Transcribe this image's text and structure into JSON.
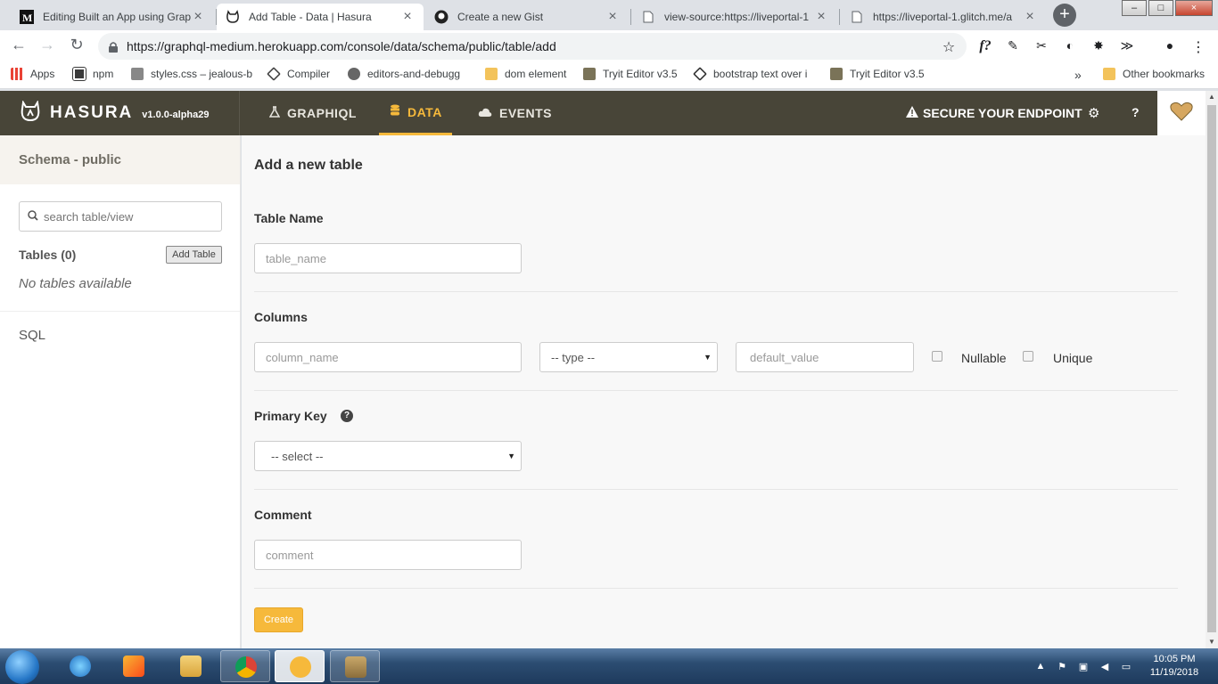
{
  "browser": {
    "tabs": [
      {
        "title": "Editing Built an App using Grap",
        "icon": "medium-icon"
      },
      {
        "title": "Add Table - Data | Hasura",
        "icon": "hasura-icon",
        "active": true
      },
      {
        "title": "Create a new Gist",
        "icon": "github-icon"
      },
      {
        "title": "view-source:https://liveportal-1",
        "icon": "page-icon"
      },
      {
        "title": "https://liveportal-1.glitch.me/a",
        "icon": "page-icon"
      }
    ],
    "new_tab": "+",
    "url": "https://graphql-medium.herokuapp.com/console/data/schema/public/table/add",
    "bookmarks": [
      {
        "label": "Apps"
      },
      {
        "label": "npm"
      },
      {
        "label": "styles.css – jealous-b"
      },
      {
        "label": "Compiler"
      },
      {
        "label": "editors-and-debugg"
      },
      {
        "label": "dom element"
      },
      {
        "label": "Tryit Editor v3.5"
      },
      {
        "label": "bootstrap text over i"
      },
      {
        "label": "Tryit Editor v3.5"
      }
    ],
    "bookmarks_more": "»",
    "other_bookmarks": "Other bookmarks"
  },
  "header": {
    "brand": "HASURA",
    "version": "v1.0.0-alpha29",
    "nav": [
      {
        "label": "GRAPHIQL",
        "icon": "flask-icon"
      },
      {
        "label": "DATA",
        "icon": "database-icon",
        "active": true
      },
      {
        "label": "EVENTS",
        "icon": "cloud-icon"
      }
    ],
    "secure": "SECURE YOUR ENDPOINT",
    "help": "?"
  },
  "sidebar": {
    "schema": "Schema - public",
    "search_placeholder": "search table/view",
    "tables_label": "Tables (0)",
    "add_table": "Add Table",
    "no_tables": "No tables available",
    "sql": "SQL"
  },
  "form": {
    "title": "Add a new table",
    "table_name_label": "Table Name",
    "table_name_placeholder": "table_name",
    "columns_label": "Columns",
    "column_name_placeholder": "column_name",
    "type_select": "-- type --",
    "default_value_placeholder": "default_value",
    "nullable": "Nullable",
    "unique": "Unique",
    "primary_key_label": "Primary Key",
    "primary_key_select": "-- select --",
    "comment_label": "Comment",
    "comment_placeholder": "comment",
    "create": "Create"
  },
  "taskbar": {
    "time": "10:05 PM",
    "date": "11/19/2018"
  },
  "colors": {
    "header_bg": "#484538",
    "accent": "#f6b93b"
  }
}
